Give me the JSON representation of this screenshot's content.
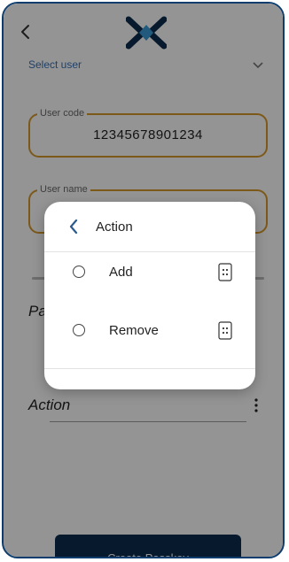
{
  "header": {
    "back_icon": "chevron-left-icon",
    "logo_icon": "brand-x-logo"
  },
  "form": {
    "select_user_label": "Select user",
    "user_code_label": "User code",
    "user_code_value": "12345678901234",
    "user_name_label": "User name",
    "user_name_value": "",
    "pa_partial": "Pa",
    "action_label": "Action",
    "create_button_label": "Create Passkey"
  },
  "dialog": {
    "title": "Action",
    "options": [
      {
        "label": "Add",
        "selected": false,
        "icon": "keypad-icon"
      },
      {
        "label": "Remove",
        "selected": false,
        "icon": "keypad-icon"
      }
    ]
  },
  "colors": {
    "accent_border": "#d79a2b",
    "primary_dark": "#0d2d4f",
    "frame": "#0d3d6e",
    "link_blue": "#3a6fb0"
  }
}
